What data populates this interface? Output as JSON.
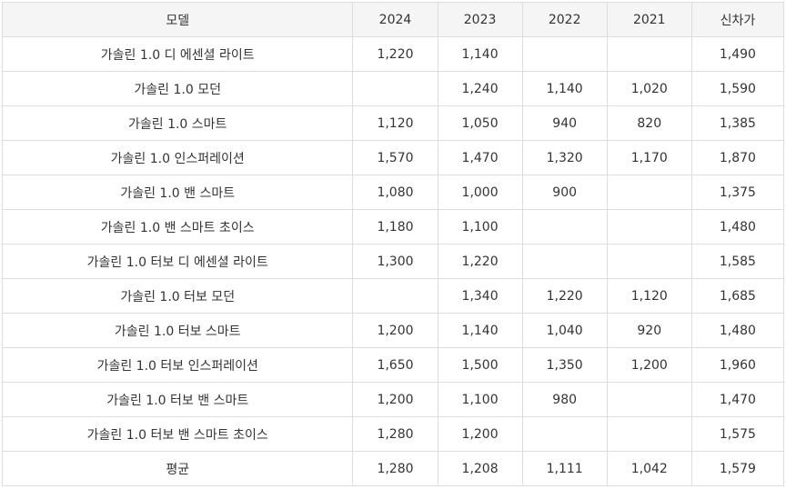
{
  "table": {
    "headers": [
      "모델",
      "2024",
      "2023",
      "2022",
      "2021",
      "신차가"
    ],
    "rows": [
      [
        "가솔린 1.0 디 에센셜 라이트",
        "1,220",
        "1,140",
        "",
        "",
        "1,490"
      ],
      [
        "가솔린 1.0 모던",
        "",
        "1,240",
        "1,140",
        "1,020",
        "1,590"
      ],
      [
        "가솔린 1.0 스마트",
        "1,120",
        "1,050",
        "940",
        "820",
        "1,385"
      ],
      [
        "가솔린 1.0 인스퍼레이션",
        "1,570",
        "1,470",
        "1,320",
        "1,170",
        "1,870"
      ],
      [
        "가솔린 1.0 밴 스마트",
        "1,080",
        "1,000",
        "900",
        "",
        "1,375"
      ],
      [
        "가솔린 1.0 밴 스마트 초이스",
        "1,180",
        "1,100",
        "",
        "",
        "1,480"
      ],
      [
        "가솔린 1.0 터보 디 에센셜 라이트",
        "1,300",
        "1,220",
        "",
        "",
        "1,585"
      ],
      [
        "가솔린 1.0 터보 모던",
        "",
        "1,340",
        "1,220",
        "1,120",
        "1,685"
      ],
      [
        "가솔린 1.0 터보 스마트",
        "1,200",
        "1,140",
        "1,040",
        "920",
        "1,480"
      ],
      [
        "가솔린 1.0 터보 인스퍼레이션",
        "1,650",
        "1,500",
        "1,350",
        "1,200",
        "1,960"
      ],
      [
        "가솔린 1.0 터보 밴 스마트",
        "1,200",
        "1,100",
        "980",
        "",
        "1,470"
      ],
      [
        "가솔린 1.0 터보 밴 스마트 초이스",
        "1,280",
        "1,200",
        "",
        "",
        "1,575"
      ],
      [
        "평균",
        "1,280",
        "1,208",
        "1,111",
        "1,042",
        "1,579"
      ]
    ]
  },
  "colors": {
    "header_bg": "#f5f5f5",
    "border": "#dddddd",
    "text": "#333333"
  }
}
